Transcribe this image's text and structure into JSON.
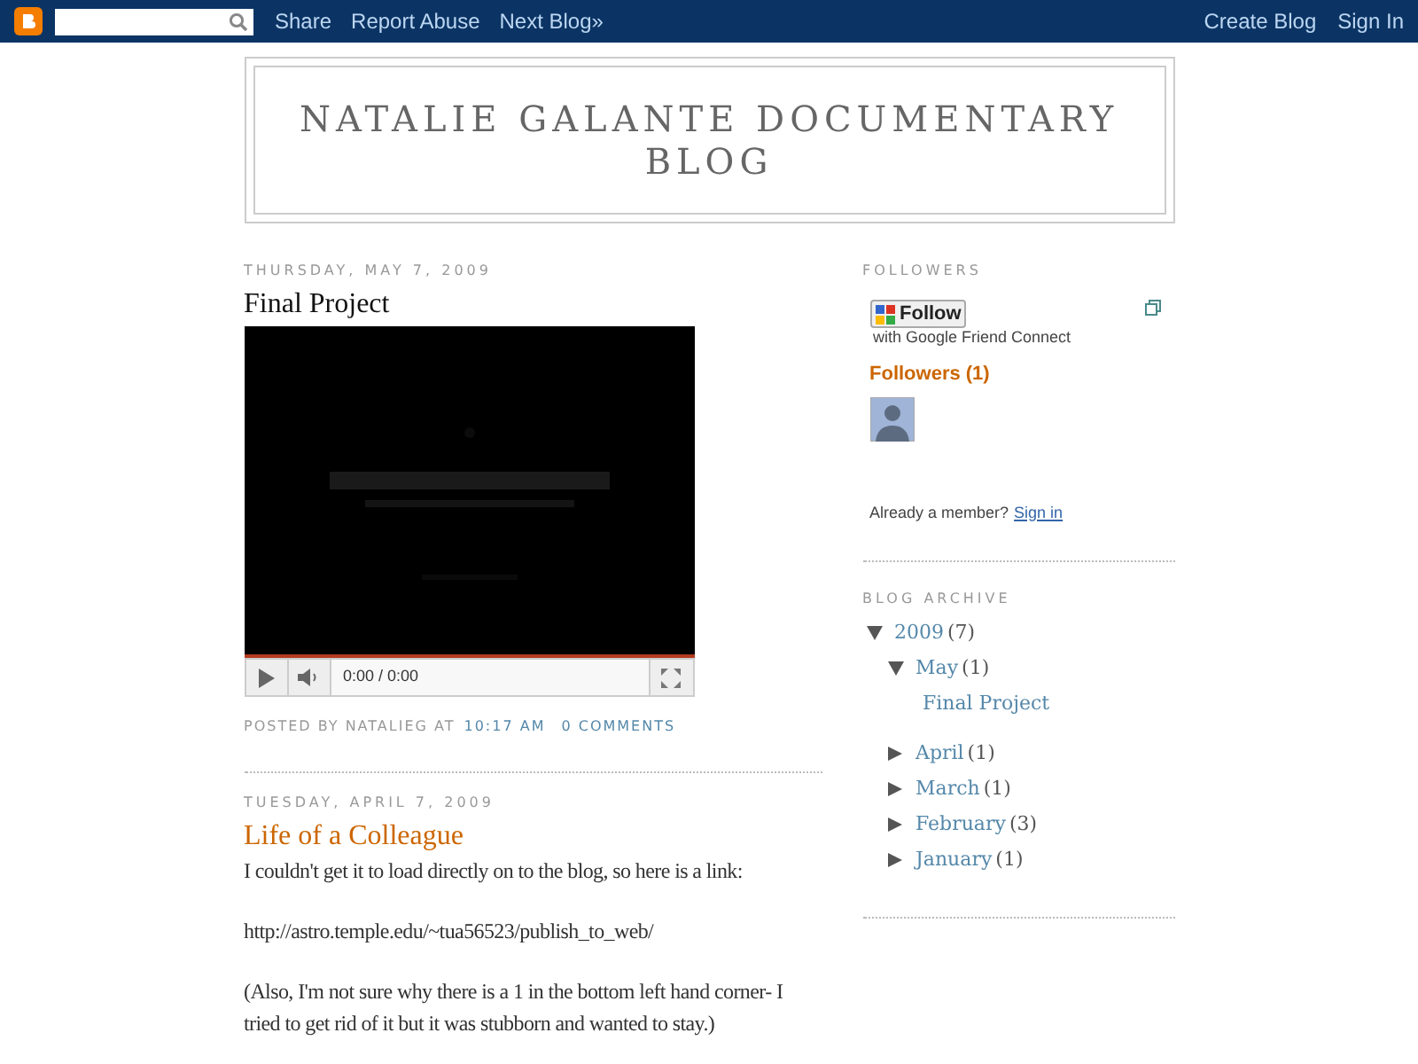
{
  "navbar": {
    "links": [
      "Share",
      "Report Abuse",
      "Next Blog»"
    ],
    "right_links": [
      "Create Blog",
      "Sign In"
    ]
  },
  "header": {
    "title": "NATALIE GALANTE DOCUMENTARY BLOG"
  },
  "posts": [
    {
      "kind": "video",
      "date": "THURSDAY, MAY 7, 2009",
      "title": "Final Project",
      "highlighted": false,
      "video": {
        "kind": "picture",
        "time": "0:00 / 0:00"
      },
      "footer": {
        "prefix": "POSTED BY NATALIEG AT",
        "time": "10:17 AM",
        "comments": "0 COMMENTS"
      }
    },
    {
      "kind": "text",
      "date": "TUESDAY, APRIL 7, 2009",
      "title": "Life of a Colleague",
      "highlighted": true,
      "paragraphs": [
        "I couldn't get it to load directly on to the blog, so here is a link:",
        "http://astro.temple.edu/~tua56523/publish_to_web/",
        "(Also, I'm not sure why there is a 1 in the bottom left hand corner- I tried to get rid of it but it was stubborn and wanted to stay.)"
      ]
    }
  ],
  "followers": {
    "heading": "FOLLOWERS",
    "follow_button": "Follow",
    "connect_text": "with Google Friend Connect",
    "count_label": "Followers (1)",
    "member_text": "Already a member?",
    "sign_in": "Sign in"
  },
  "archive": {
    "heading": "BLOG ARCHIVE",
    "items": [
      {
        "label": "2009",
        "count": "(7)",
        "expanded": true,
        "children": [
          {
            "label": "May",
            "count": "(1)",
            "expanded": true,
            "children": [
              {
                "label": "Final Project"
              }
            ]
          },
          {
            "label": "April",
            "count": "(1)",
            "expanded": false
          },
          {
            "label": "March",
            "count": "(1)",
            "expanded": false
          },
          {
            "label": "February",
            "count": "(3)",
            "expanded": false
          },
          {
            "label": "January",
            "count": "(1)",
            "expanded": false
          }
        ]
      }
    ]
  }
}
